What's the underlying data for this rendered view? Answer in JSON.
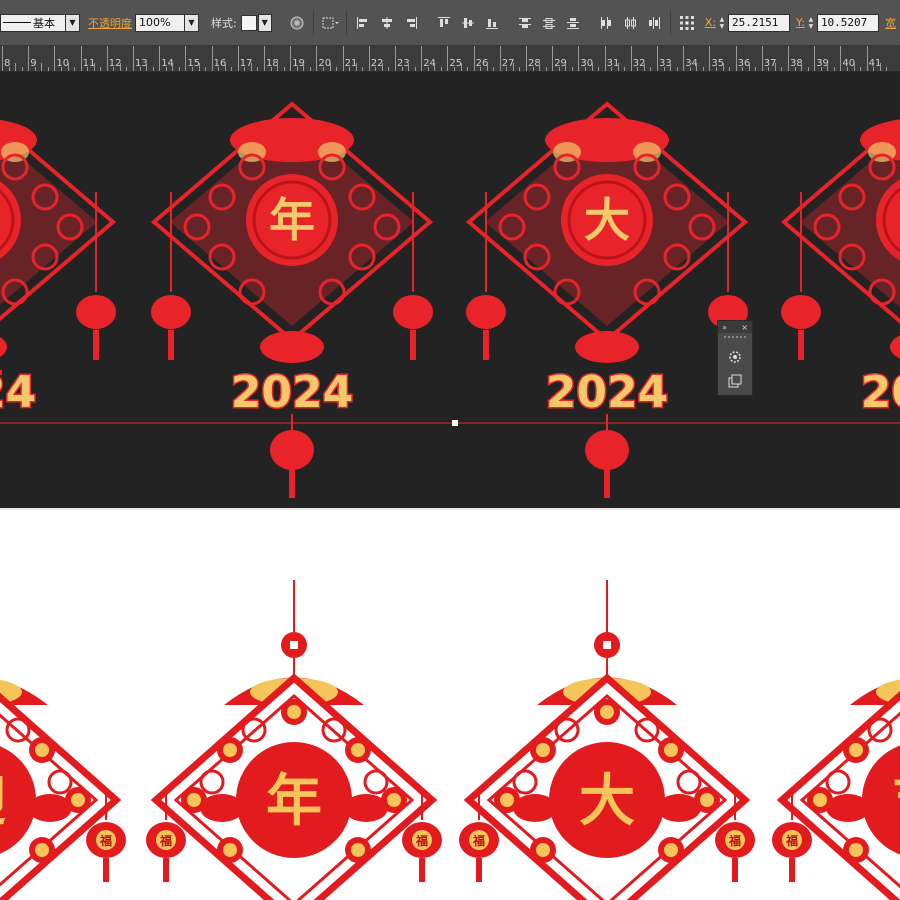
{
  "control_bar": {
    "stroke_profile": "基本",
    "opacity_label": "不透明度",
    "opacity_value": "100%",
    "style_label": "样式:",
    "x_label": "X:",
    "x_value": "25.2151",
    "y_label": "Y:",
    "y_value": "10.5207",
    "width_label": "宽",
    "tool_icons": [
      "recolor-icon",
      "transform-reference-icon",
      "align-left-icon",
      "align-h-center-icon",
      "align-right-icon",
      "align-top-icon",
      "align-v-center-icon",
      "align-bottom-icon",
      "distribute-top-icon",
      "distribute-v-center-icon",
      "distribute-bottom-icon",
      "distribute-left-icon",
      "distribute-h-center-icon",
      "distribute-right-icon"
    ]
  },
  "ruler": {
    "ticks": [
      "8",
      "9",
      "10",
      "11",
      "12",
      "13",
      "14",
      "15",
      "16",
      "17",
      "18",
      "19",
      "20",
      "21",
      "22",
      "23",
      "24",
      "25",
      "26",
      "27",
      "28",
      "29",
      "30",
      "31",
      "32",
      "33",
      "34",
      "35",
      "36",
      "37",
      "38",
      "39",
      "40",
      "41"
    ]
  },
  "artboard": {
    "characters": [
      "迎",
      "年",
      "大",
      "吉"
    ],
    "year": "2024",
    "colors": {
      "red": "#e8242a",
      "gold": "#f5c96b",
      "dark": "#232323"
    }
  },
  "float_panel": {
    "icons": [
      "appearance-icon",
      "artboards-icon"
    ]
  },
  "preview": {
    "characters": [
      "迎",
      "年",
      "大",
      "吉"
    ],
    "tassel_char": "福",
    "colors": {
      "red": "#e21b1f",
      "gold": "#f6c55a",
      "dark_red": "#c00d12"
    }
  }
}
